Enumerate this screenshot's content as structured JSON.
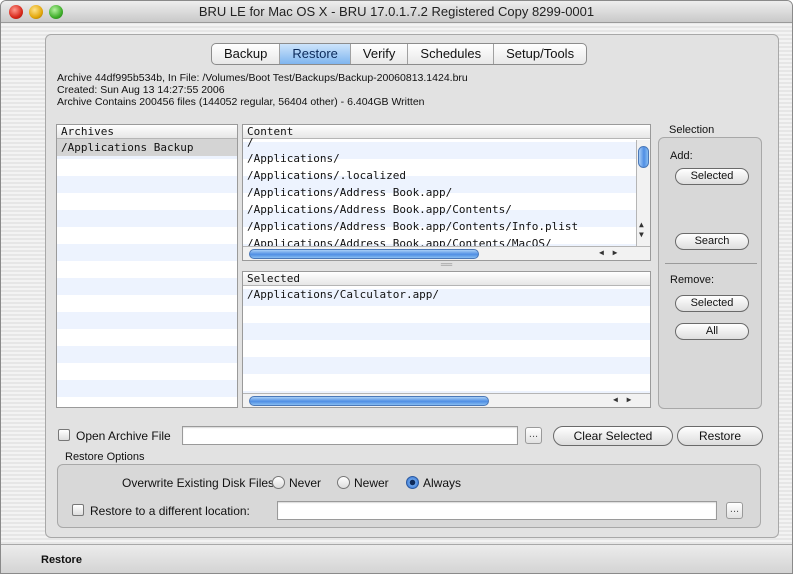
{
  "window": {
    "title": "BRU LE for Mac OS X - BRU 17.0.1.7.2 Registered Copy 8299-0001"
  },
  "tabs": [
    "Backup",
    "Restore",
    "Verify",
    "Schedules",
    "Setup/Tools"
  ],
  "active_tab": "Restore",
  "archive_info": {
    "line1": "Archive 44df995b534b, In File: /Volumes/Boot Test/Backups/Backup-20060813.1424.bru",
    "line2": "Created: Sun Aug 13 14:27:55 2006",
    "line3": "Archive Contains 200456 files (144052 regular, 56404 other) - 6.404GB Written"
  },
  "archives": {
    "header": "Archives",
    "items": [
      "/Applications Backup"
    ]
  },
  "content": {
    "header": "Content",
    "items": [
      "/",
      "/Applications/",
      "/Applications/.localized",
      "/Applications/Address Book.app/",
      "/Applications/Address Book.app/Contents/",
      "/Applications/Address Book.app/Contents/Info.plist",
      "/Applications/Address Book.app/Contents/MacOS/"
    ]
  },
  "selected": {
    "header": "Selected",
    "items": [
      "/Applications/Calculator.app/"
    ]
  },
  "selection_panel": {
    "title": "Selection",
    "add_label": "Add:",
    "add_selected": "Selected",
    "search": "Search",
    "remove_label": "Remove:",
    "remove_selected": "Selected",
    "remove_all": "All"
  },
  "open_archive": {
    "label": "Open Archive File",
    "value": "",
    "browse": "..."
  },
  "buttons": {
    "clear_selected": "Clear Selected",
    "restore": "Restore"
  },
  "restore_options": {
    "title": "Restore Options",
    "overwrite_label": "Overwrite Existing Disk Files",
    "choices": [
      "Never",
      "Newer",
      "Always"
    ],
    "selected_choice": "Always",
    "different_location_label": "Restore to a different location:",
    "different_location_value": "",
    "browse": "..."
  },
  "status_bar": {
    "text": "Restore"
  }
}
